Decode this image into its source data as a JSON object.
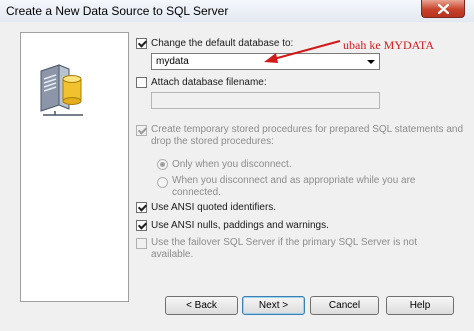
{
  "window": {
    "title": "Create a New Data Source to SQL Server",
    "close_icon": "close-icon",
    "accent_close_color": "#c7432b"
  },
  "sidebar": {
    "icon": "database-server-icon"
  },
  "options": {
    "change_db": {
      "label": "Change the default database to:",
      "checked": true
    },
    "database_dropdown": {
      "value": "mydata",
      "icon": "chevron-down-icon"
    },
    "attach_db": {
      "label": "Attach database filename:",
      "checked": false
    },
    "attach_db_field": {
      "value": ""
    },
    "create_temp": {
      "line1": "Create temporary stored procedures for prepared SQL statements and",
      "line2": "drop the stored procedures:",
      "checked": true,
      "enabled": false
    },
    "radio_disconnect": {
      "label": "Only when you disconnect.",
      "selected": true,
      "enabled": false
    },
    "radio_appropriate": {
      "line1": "When you disconnect and as appropriate while you are",
      "line2": "connected.",
      "selected": false,
      "enabled": false
    },
    "ansi_quoted": {
      "label": "Use ANSI quoted identifiers.",
      "checked": true
    },
    "ansi_nulls": {
      "label": "Use ANSI nulls, paddings and warnings.",
      "checked": true
    },
    "failover": {
      "line1": "Use the failover SQL Server if the primary SQL Server is not",
      "line2": "available.",
      "checked": false,
      "enabled": false
    }
  },
  "annotation": {
    "text": "ubah ke MYDATA",
    "color": "#d21a1a"
  },
  "buttons": {
    "back": "< Back",
    "next": "Next >",
    "cancel": "Cancel",
    "help": "Help"
  }
}
